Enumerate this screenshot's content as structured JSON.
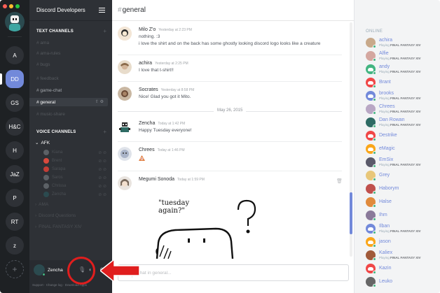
{
  "window": {
    "title": "Discord Developers"
  },
  "guilds": {
    "items": [
      {
        "label": "A"
      },
      {
        "label": "DD"
      },
      {
        "label": "GS"
      },
      {
        "label": "H&C"
      },
      {
        "label": "H"
      },
      {
        "label": "JaZ"
      },
      {
        "label": "P"
      },
      {
        "label": "RT"
      },
      {
        "label": "z"
      }
    ],
    "add_label": "+"
  },
  "sidebar": {
    "text_category": "TEXT CHANNELS",
    "text_channels": [
      {
        "label": "# ama"
      },
      {
        "label": "# ama-rules"
      },
      {
        "label": "# bugs"
      },
      {
        "label": "# feedback"
      },
      {
        "label": "# game-chat"
      },
      {
        "label": "# general"
      },
      {
        "label": "# music-share"
      }
    ],
    "voice_category": "VOICE CHANNELS",
    "voice_afk": "AFK",
    "voice_users": [
      {
        "name": "Kiana",
        "color": "#5c6166"
      },
      {
        "name": "Brent",
        "color": "#d94a3d"
      },
      {
        "name": "Sarapa",
        "color": "#c23e36"
      },
      {
        "name": "Saros",
        "color": "#5c6166"
      },
      {
        "name": "Chrissa",
        "color": "#5c6166"
      },
      {
        "name": "Zencha",
        "color": "#2b4a4f"
      }
    ],
    "voice_channels": [
      {
        "label": "AMA"
      },
      {
        "label": "Discord Questions"
      },
      {
        "label": "FINAL FANTASY XIV"
      }
    ],
    "user": {
      "name": "Zencha"
    },
    "footer_links": "Support · Change log · Download Apps"
  },
  "chat": {
    "channel": "general",
    "messages": [
      {
        "author": "Milo Z'o",
        "timestamp": "Yesterday at 2:23 PM",
        "lines": [
          "nothing. :3",
          "i love the shirt and on the back has some ghostly looking discord logo looks like a creature"
        ]
      },
      {
        "author": "achira",
        "timestamp": "Yesterday at 2:25 PM",
        "lines": [
          "I love that t-shirt!!"
        ]
      },
      {
        "author": "Socrates",
        "timestamp": "Yesterday at 8:58 PM",
        "lines": [
          "Nice! Glad you got it Mito."
        ]
      },
      {
        "author": "Zencha",
        "timestamp": "Today at 1:42 PM",
        "lines": [
          "Happy Tuesday everyone!"
        ]
      },
      {
        "author": "Chrees",
        "timestamp": "Today at 1:46 PM",
        "lines": []
      },
      {
        "author": "Megumi Sonoda",
        "timestamp": "Today at 1:59 PM",
        "lines": []
      }
    ],
    "date_divider": "May 26, 2015",
    "attachment_text": [
      "\"tuesday",
      "again?\""
    ],
    "input_placeholder": "Chat in general..."
  },
  "members": {
    "header": "ONLINE",
    "list": [
      {
        "name": "achira",
        "game": "FINAL FANTASY XIV",
        "color": "#c8a98a"
      },
      {
        "name": "Alfie",
        "game": "FINAL FANTASY XIV",
        "color": "#d4a7a0"
      },
      {
        "name": "andy",
        "game": "FINAL FANTASY XIV",
        "color": "#43b581"
      },
      {
        "name": "Brant",
        "game": "",
        "color": "#f04747"
      },
      {
        "name": "brooks",
        "game": "FINAL FANTASY XIV",
        "color": "#7289da"
      },
      {
        "name": "Chrees",
        "game": "FINAL FANTASY XIV",
        "color": "#b9a7c4"
      },
      {
        "name": "Dan Rowan",
        "game": "FINAL FANTASY XIV",
        "color": "#2e6b64"
      },
      {
        "name": "Destrike",
        "game": "",
        "color": "#f04747"
      },
      {
        "name": "eMagic",
        "game": "",
        "color": "#faa61a"
      },
      {
        "name": "EmSix",
        "game": "FINAL FANTASY XIV",
        "color": "#5a5a6a"
      },
      {
        "name": "Grey",
        "game": "",
        "color": "#e8c77a"
      },
      {
        "name": "Haborym",
        "game": "",
        "color": "#c0504d"
      },
      {
        "name": "Halse",
        "game": "",
        "color": "#e08a3c"
      },
      {
        "name": "Ihm",
        "game": "",
        "color": "#8a7a9a"
      },
      {
        "name": "Ilban",
        "game": "FINAL FANTASY XIV",
        "color": "#7289da"
      },
      {
        "name": "jason",
        "game": "",
        "color": "#faa61a"
      },
      {
        "name": "Kaliex",
        "game": "FINAL FANTASY XIV",
        "color": "#a05a3a"
      },
      {
        "name": "Kazin",
        "game": "",
        "color": "#f04747"
      },
      {
        "name": "Leuko",
        "game": "",
        "color": "#666666"
      }
    ],
    "playing_label": "Playing"
  }
}
